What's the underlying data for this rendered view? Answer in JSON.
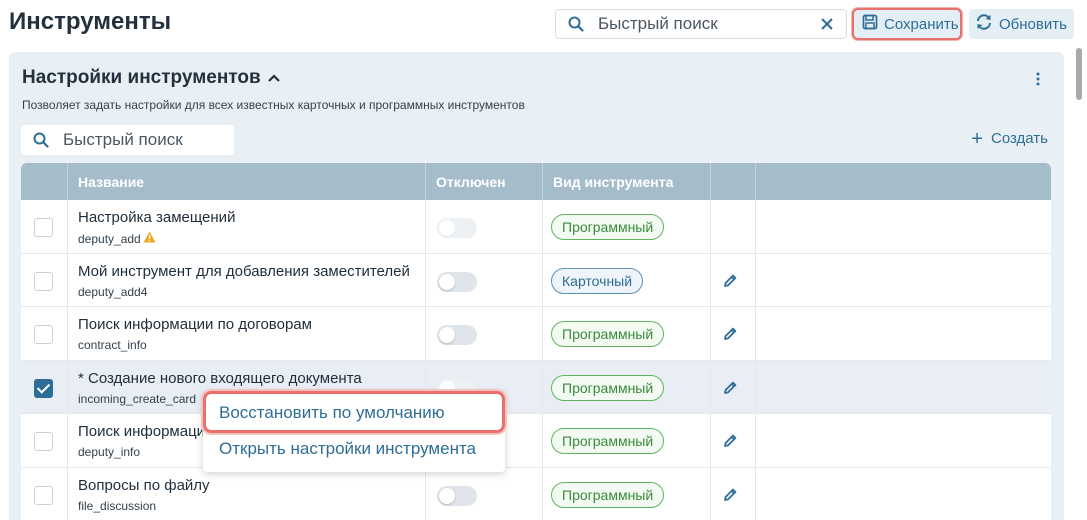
{
  "header": {
    "title": "Инструменты",
    "search_placeholder": "Быстрый поиск",
    "save_label": "Сохранить",
    "refresh_label": "Обновить"
  },
  "panel": {
    "title": "Настройки инструментов",
    "description": "Позволяет задать настройки для всех известных карточных и программных инструментов",
    "search_placeholder": "Быстрый поиск",
    "create_label": "Создать"
  },
  "table": {
    "columns": [
      "",
      "Название",
      "Отключен",
      "Вид инструмента",
      "",
      ""
    ],
    "rows": [
      {
        "name": "Настройка замещений",
        "code": "deputy_add",
        "type": "Программный",
        "checked": false,
        "warning": true,
        "editable": false
      },
      {
        "name": "Мой инструмент для добавления заместителей",
        "code": "deputy_add4",
        "type": "Карточный",
        "checked": false,
        "warning": false,
        "editable": true
      },
      {
        "name": "Поиск информации по договорам",
        "code": "contract_info",
        "type": "Программный",
        "checked": false,
        "warning": false,
        "editable": true
      },
      {
        "name": " * Создание нового входящего документа",
        "code": "incoming_create_card",
        "type": "Программный",
        "checked": true,
        "warning": false,
        "editable": true
      },
      {
        "name": "Поиск информаци",
        "code": "deputy_info",
        "type": "Программный",
        "checked": false,
        "warning": false,
        "editable": true
      },
      {
        "name": "Вопросы по файлу",
        "code": "file_discussion",
        "type": "Программный",
        "checked": false,
        "warning": false,
        "editable": true
      }
    ]
  },
  "context_menu": {
    "items": [
      "Восстановить по умолчанию",
      "Открыть настройки инструмента"
    ]
  },
  "colors": {
    "accent": "#2e6e96",
    "header_bg": "#a5bccb",
    "highlight": "#e8716d",
    "badge_program": "#62b463"
  }
}
